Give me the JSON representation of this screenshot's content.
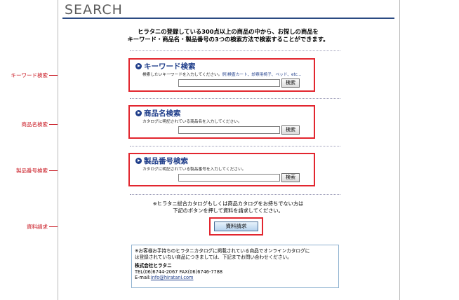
{
  "page": {
    "title": "SEARCH",
    "intro_line1": "ヒラタニの登録している300点以上の商品の中から、お探しの商品を",
    "intro_line2": "キーワード・商品名・製品番号の3つの検索方法で検索することができます。"
  },
  "sections": [
    {
      "title": "キーワード検索",
      "desc": "検索したいキーワードを入力してください。",
      "example": "例)検査カート、診察用椅子、ベッド、etc...",
      "button": "検索",
      "value": ""
    },
    {
      "title": "商品名検索",
      "desc": "カタログに明記されている商品名を入力してください。",
      "example": "",
      "button": "検索",
      "value": ""
    },
    {
      "title": "製品番号検索",
      "desc": "カタログに明記されている製品番号を入力してください。",
      "example": "",
      "button": "検索",
      "value": ""
    }
  ],
  "catalog": {
    "note_line1": "※ヒラタニ総合カタログもしくは商品カタログをお持ちでない方は",
    "note_line2": "下記のボタンを押して資料を請求してください。",
    "button": "資料請求"
  },
  "contact": {
    "line1": "※お客様お手持ちのヒラタニカタログに掲載されている商品でオンラインカタログに",
    "line2": "は登録されていない商品につきましては、下記までお問い合わせください。",
    "company": "株式会社ヒラタニ",
    "phone": "TEL(06)6744-2067  FAX(06)6746-7788",
    "email_label": "E-mail:",
    "email": "info@hiratani.com"
  },
  "annotations": {
    "keyword": "キーワード検索",
    "product_name": "商品名検索",
    "product_number": "製品番号検索",
    "request": "資料請求"
  },
  "colors": {
    "accent": "#1e3d8a",
    "highlight": "#e2262f",
    "annotation": "#c8141e"
  }
}
